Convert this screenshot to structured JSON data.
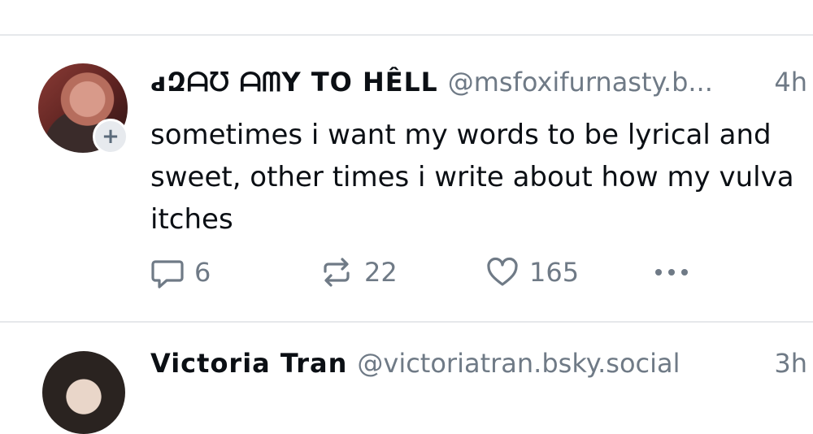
{
  "post": {
    "display_name": "ԁԶᗩᘮ ᗩᗰY TO ᕼÊᒪᒪ",
    "handle": "@msfoxifurnasty.b...",
    "time": "4h",
    "text": "sometimes i want my words to be lyrical and sweet, other times i write about how my vulva itches",
    "follow_badge": "+",
    "actions": {
      "reply_count": "6",
      "repost_count": "22",
      "like_count": "165"
    },
    "icons": {
      "reply": "reply-bubble-icon",
      "repost": "repost-arrows-icon",
      "like": "heart-icon",
      "more": "ellipsis-icon"
    }
  },
  "next_post": {
    "display_name": "Victoria Tran",
    "handle": "@victoriatran.bsky.social",
    "time": "3h"
  },
  "colors": {
    "text": "#0b0f14",
    "muted": "#6f7a86",
    "divider": "#e6e8eb",
    "badge_bg": "#e7eaee"
  }
}
